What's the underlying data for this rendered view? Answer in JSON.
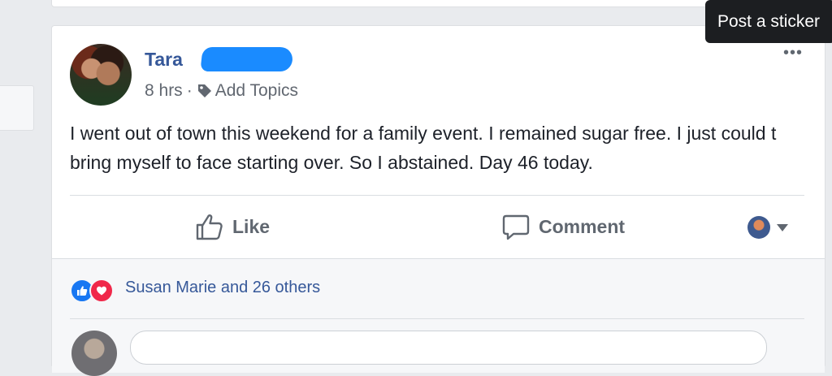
{
  "post": {
    "author": {
      "name": "Tara"
    },
    "time": "8 hrs",
    "separator": "·",
    "add_topics_label": "Add Topics",
    "menu_label": "•••",
    "text": "I went out of town this weekend for a family event. I remained sugar free. I just could t bring myself to face starting over. So I abstained. Day 46 today."
  },
  "actions": {
    "like_label": "Like",
    "comment_label": "Comment"
  },
  "reactions": {
    "summary": "Susan Marie and 26 others",
    "types": [
      "like",
      "love"
    ]
  },
  "tooltip": {
    "text": "Post a sticker"
  },
  "colors": {
    "link_blue": "#365899",
    "like_blue": "#1877f2",
    "love_red": "#f0284a",
    "redaction_blue": "#1a8bff"
  }
}
